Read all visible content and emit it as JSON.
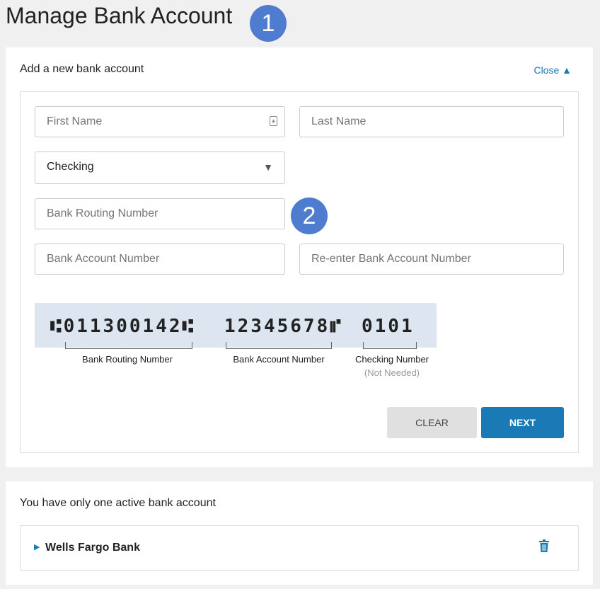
{
  "page": {
    "title": "Manage Bank Account",
    "step1": "1",
    "step2": "2"
  },
  "form": {
    "header": "Add a new bank account",
    "close_label": "Close",
    "first_name_placeholder": "First Name",
    "last_name_placeholder": "Last Name",
    "account_type": "Checking",
    "routing_placeholder": "Bank Routing Number",
    "account_placeholder": "Bank Account Number",
    "reenter_placeholder": "Re-enter Bank Account Number",
    "clear_label": "CLEAR",
    "next_label": "NEXT"
  },
  "check": {
    "routing_micr": "⑆011300142⑆",
    "account_micr": "12345678⑈",
    "check_micr": "0101",
    "routing_label": "Bank Routing Number",
    "account_label": "Bank Account Number",
    "check_label": "Checking Number",
    "check_note": "(Not Needed)"
  },
  "accounts": {
    "header": "You have only one active bank account",
    "items": [
      {
        "name": "Wells Fargo Bank"
      }
    ]
  },
  "colors": {
    "accent": "#1a7ab5",
    "badge": "#4f7ccf"
  }
}
